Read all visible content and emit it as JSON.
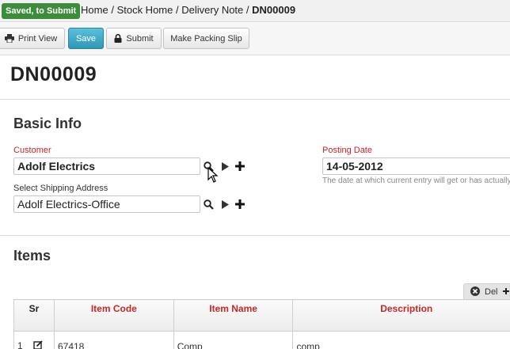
{
  "header": {
    "status": "Saved, to Submit",
    "breadcrumb": {
      "home": "Home",
      "stock_home": "Stock Home",
      "delivery_note": "Delivery Note",
      "separator": "/",
      "current": "DN00009"
    }
  },
  "toolbar": {
    "print_view": "Print View",
    "save": "Save",
    "submit": "Submit",
    "packing_slip": "Make Packing Slip"
  },
  "doc": {
    "title": "DN00009"
  },
  "basic_info": {
    "title": "Basic Info",
    "customer": {
      "label": "Customer",
      "value": "Adolf Electrics"
    },
    "shipping": {
      "label": "Select Shipping Address",
      "value": "Adolf Electrics-Office"
    },
    "posting_date": {
      "label": "Posting Date",
      "value": "14-05-2012",
      "help": "The date at which current entry will get or has actually executed."
    }
  },
  "items": {
    "title": "Items",
    "del_label": "Del",
    "columns": {
      "sr": "Sr",
      "item_code": "Item Code",
      "item_name": "Item Name",
      "description": "Description"
    },
    "rows": [
      {
        "sr": "1",
        "item_code": "67418",
        "item_name": "Comp",
        "description": "comp"
      }
    ]
  },
  "colors": {
    "status_badge": "#3d8b3d",
    "primary_button": "#2f96b4",
    "required_label": "#d02020"
  }
}
